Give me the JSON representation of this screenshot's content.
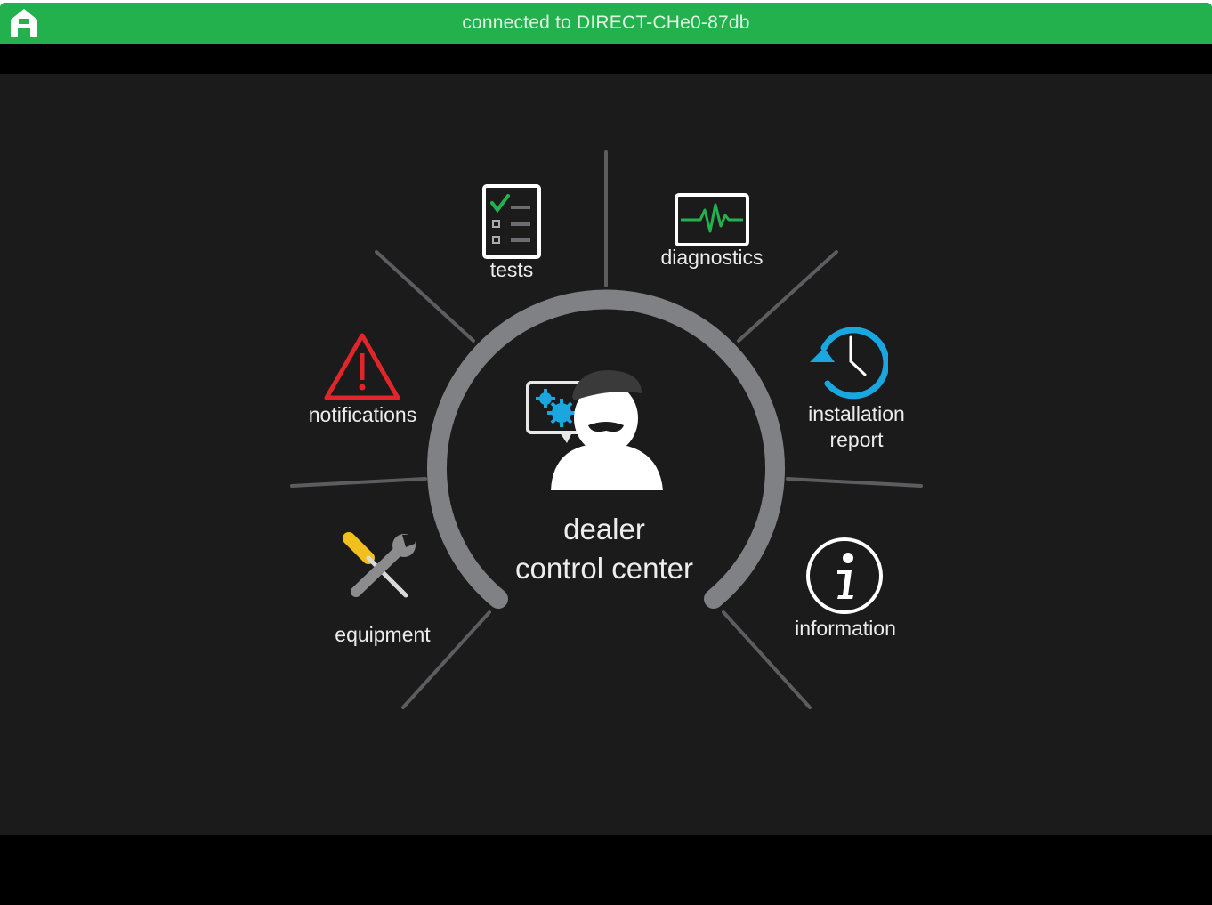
{
  "status_bar": {
    "connection_text": "connected to DIRECT-CHe0-87db",
    "home_icon": "home-icon",
    "color": "#22b14c"
  },
  "center": {
    "line1": "dealer",
    "line2": "control center",
    "icon": "dealer-avatar-icon"
  },
  "menu": {
    "tests": {
      "label": "tests",
      "icon": "checklist-icon"
    },
    "diagnostics": {
      "label": "diagnostics",
      "icon": "heartbeat-monitor-icon"
    },
    "notifications": {
      "label": "notifications",
      "icon": "warning-triangle-icon"
    },
    "installation_report": {
      "line1": "installation",
      "line2": "report",
      "icon": "history-clock-icon"
    },
    "equipment": {
      "label": "equipment",
      "icon": "tools-icon"
    },
    "information": {
      "label": "information",
      "icon": "info-icon"
    }
  },
  "colors": {
    "background": "#1b1b1b",
    "ring": "#808184",
    "accent_blue": "#1aa7e0",
    "warning_red": "#e0262a",
    "monitor_green": "#22b14c"
  }
}
